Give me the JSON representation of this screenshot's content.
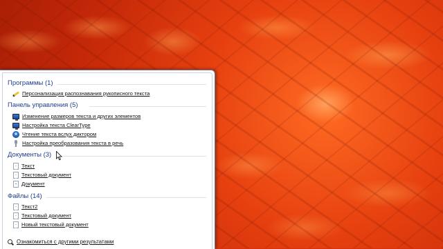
{
  "wallpaper": {
    "colors": {
      "base": "#d8320a",
      "highlight": "#ff6a22"
    }
  },
  "groups": [
    {
      "title": "Программы (1)",
      "items": [
        {
          "label": "Персонализация распознавания рукописного текста",
          "icon": "pen-icon"
        }
      ]
    },
    {
      "title": "Панель управления (5)",
      "items": [
        {
          "label": "Изменение размеров текста и других элементов",
          "icon": "monitor-icon"
        },
        {
          "label": "Настройка текста ClearType",
          "icon": "monitor-icon"
        },
        {
          "label": "Чтение текста вслух диктором",
          "icon": "narrator-icon"
        },
        {
          "label": "Настройка преобразования текста в речь",
          "icon": "microphone-icon"
        }
      ]
    },
    {
      "title": "Документы (3)",
      "items": [
        {
          "label": "Текст",
          "icon": "document-icon"
        },
        {
          "label": "Текстовый документ",
          "icon": "document-icon"
        },
        {
          "label": "Документ",
          "icon": "document-icon"
        }
      ]
    },
    {
      "title": "Файлы (14)",
      "items": [
        {
          "label": "Текст2",
          "icon": "document-icon"
        },
        {
          "label": "Текстовый документ",
          "icon": "document-icon"
        },
        {
          "label": "Новый текстовый документ",
          "icon": "document-icon"
        }
      ]
    }
  ],
  "more_results": {
    "label": "Ознакомиться с другими результатами",
    "icon": "search-icon"
  },
  "colors": {
    "header_text": "#1e3d8f",
    "panel_bg": "#ffffff",
    "rule": "#dce3ec"
  }
}
